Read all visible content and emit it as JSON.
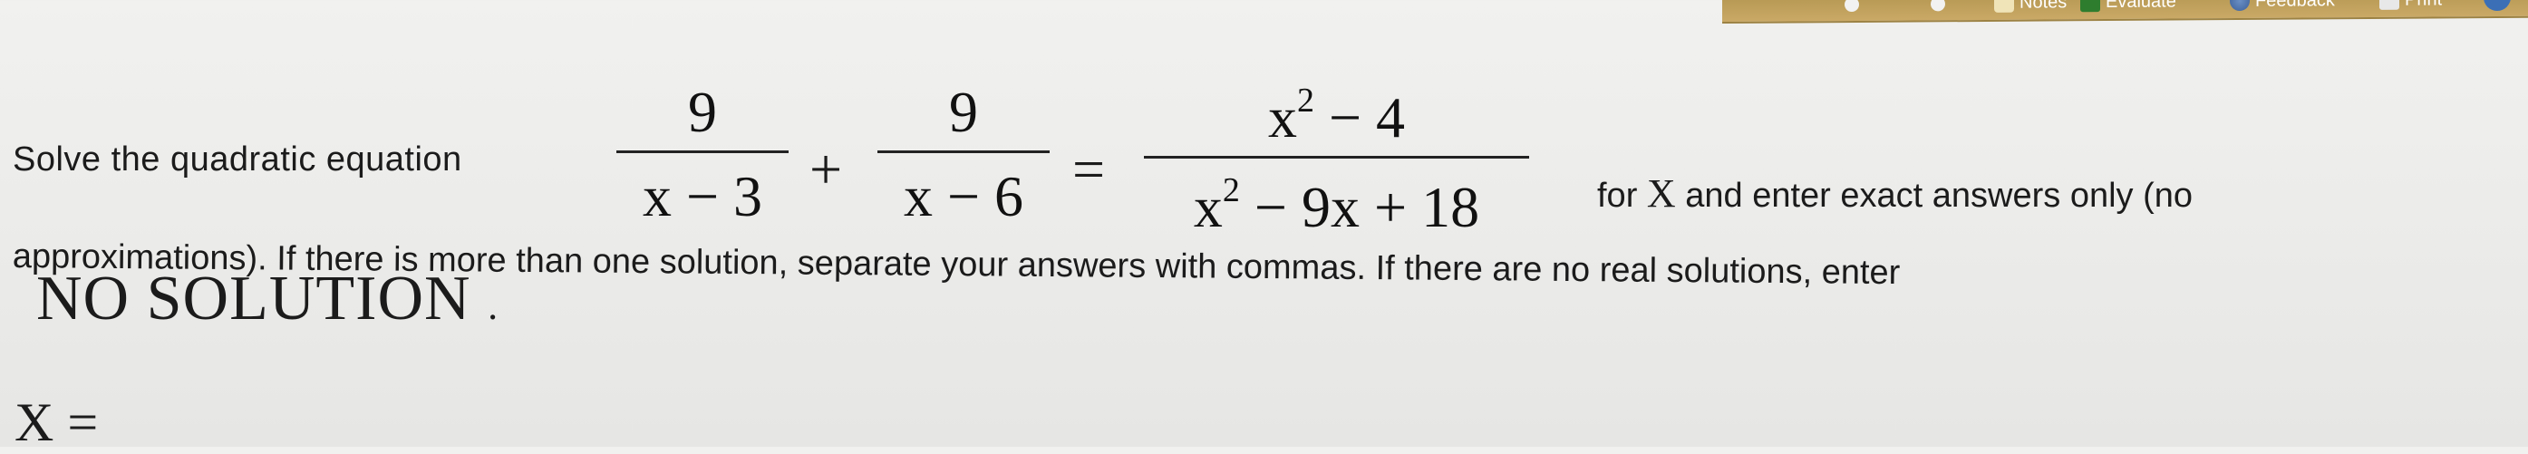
{
  "toolbar": {
    "notes": "Notes",
    "evaluate": "Evaluate",
    "feedback": "Feedback",
    "print": "Print"
  },
  "question": {
    "lead": "Solve the quadratic equation",
    "frac1": {
      "num": "9",
      "den": "x − 3"
    },
    "op_plus": "+",
    "frac2": {
      "num": "9",
      "den": "x − 6"
    },
    "op_eq": "=",
    "frac3": {
      "num_base": "x",
      "num_exp": "2",
      "num_rest": " − 4",
      "den_base": "x",
      "den_exp": "2",
      "den_rest": " − 9x + 18"
    },
    "tail_pre": "for",
    "tail_var": "X",
    "tail_post": "and enter exact answers only (no",
    "line2": "approximations). If there is more than one solution, separate your answers with commas. If there are no real solutions, enter",
    "no_solution": "NO SOLUTION",
    "no_solution_period": "."
  },
  "answer": {
    "label": "X =",
    "value": ""
  }
}
